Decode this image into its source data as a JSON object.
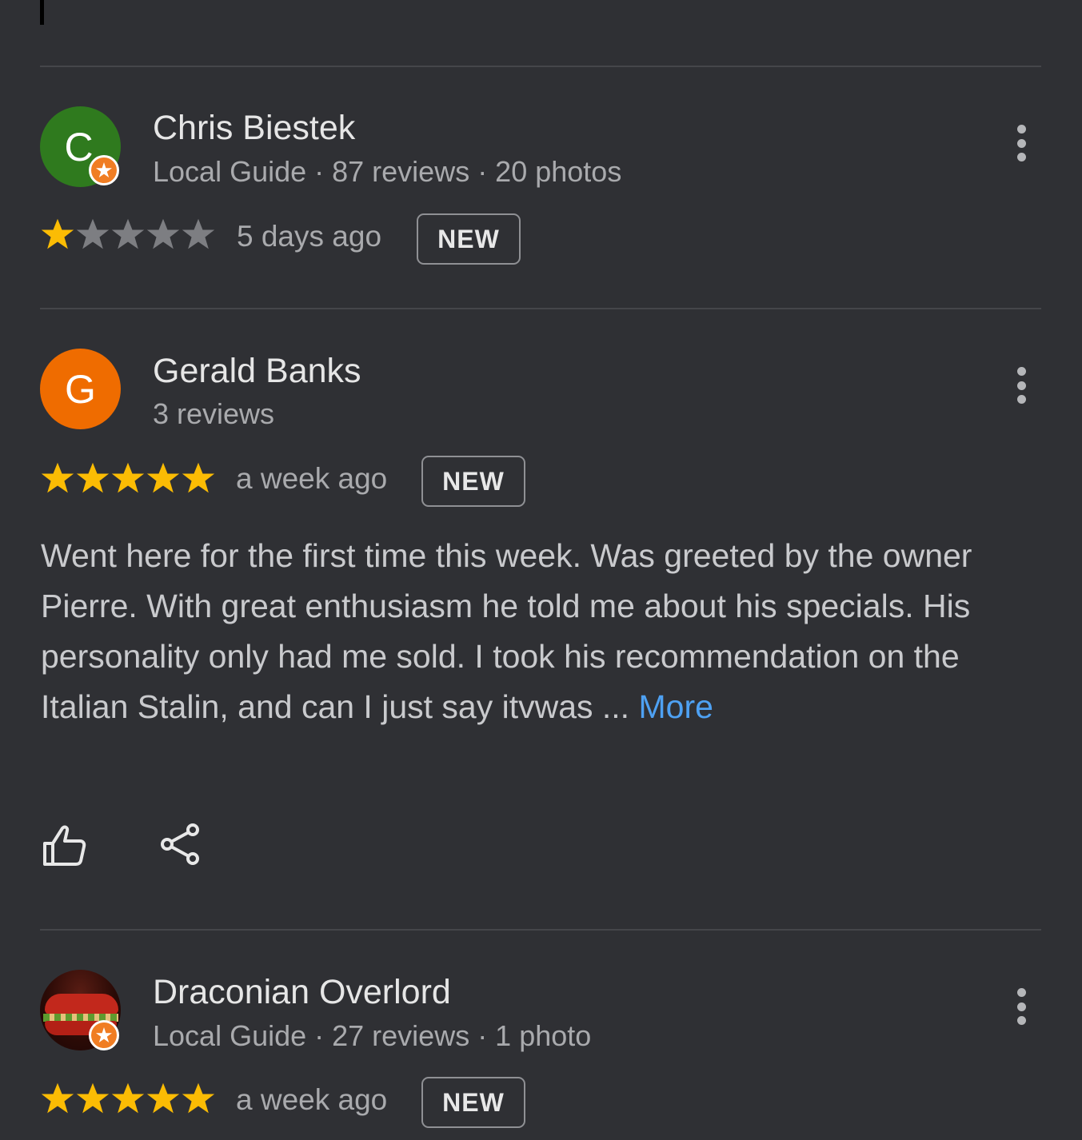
{
  "reviews": [
    {
      "name": "Chris Biestek",
      "avatar_letter": "C",
      "avatar_color": "#2f7a1e",
      "meta": "Local Guide · 87 reviews · 20 photos",
      "local_guide": true,
      "rating": 1,
      "max_rating": 5,
      "time": "5 days ago",
      "tag": "NEW"
    },
    {
      "name": "Gerald Banks",
      "avatar_letter": "G",
      "avatar_color": "#ef6c00",
      "meta": "3 reviews",
      "local_guide": false,
      "rating": 5,
      "max_rating": 5,
      "time": "a week ago",
      "tag": "NEW",
      "text": "Went here for the first time this week. Was greeted by the owner Pierre. With great enthusiasm he told me about his specials. His personality only had me sold. I took his recommendation on the Italian Stalin, and can I just say itvwas ... ",
      "more_label": "More",
      "actions": [
        "thumbs-up-icon",
        "share-icon"
      ]
    },
    {
      "name": "Draconian Overlord",
      "avatar_image": "sandwich photo",
      "meta": "Local Guide · 27 reviews · 1 photo",
      "local_guide": true,
      "rating": 5,
      "max_rating": 5,
      "time": "a week ago",
      "tag": "NEW"
    }
  ],
  "colors": {
    "background": "#2f3034",
    "star_filled": "#fbbc04",
    "star_empty": "#7d7e82",
    "link": "#4ea1f3",
    "local_guide_badge": "#f07d23"
  }
}
